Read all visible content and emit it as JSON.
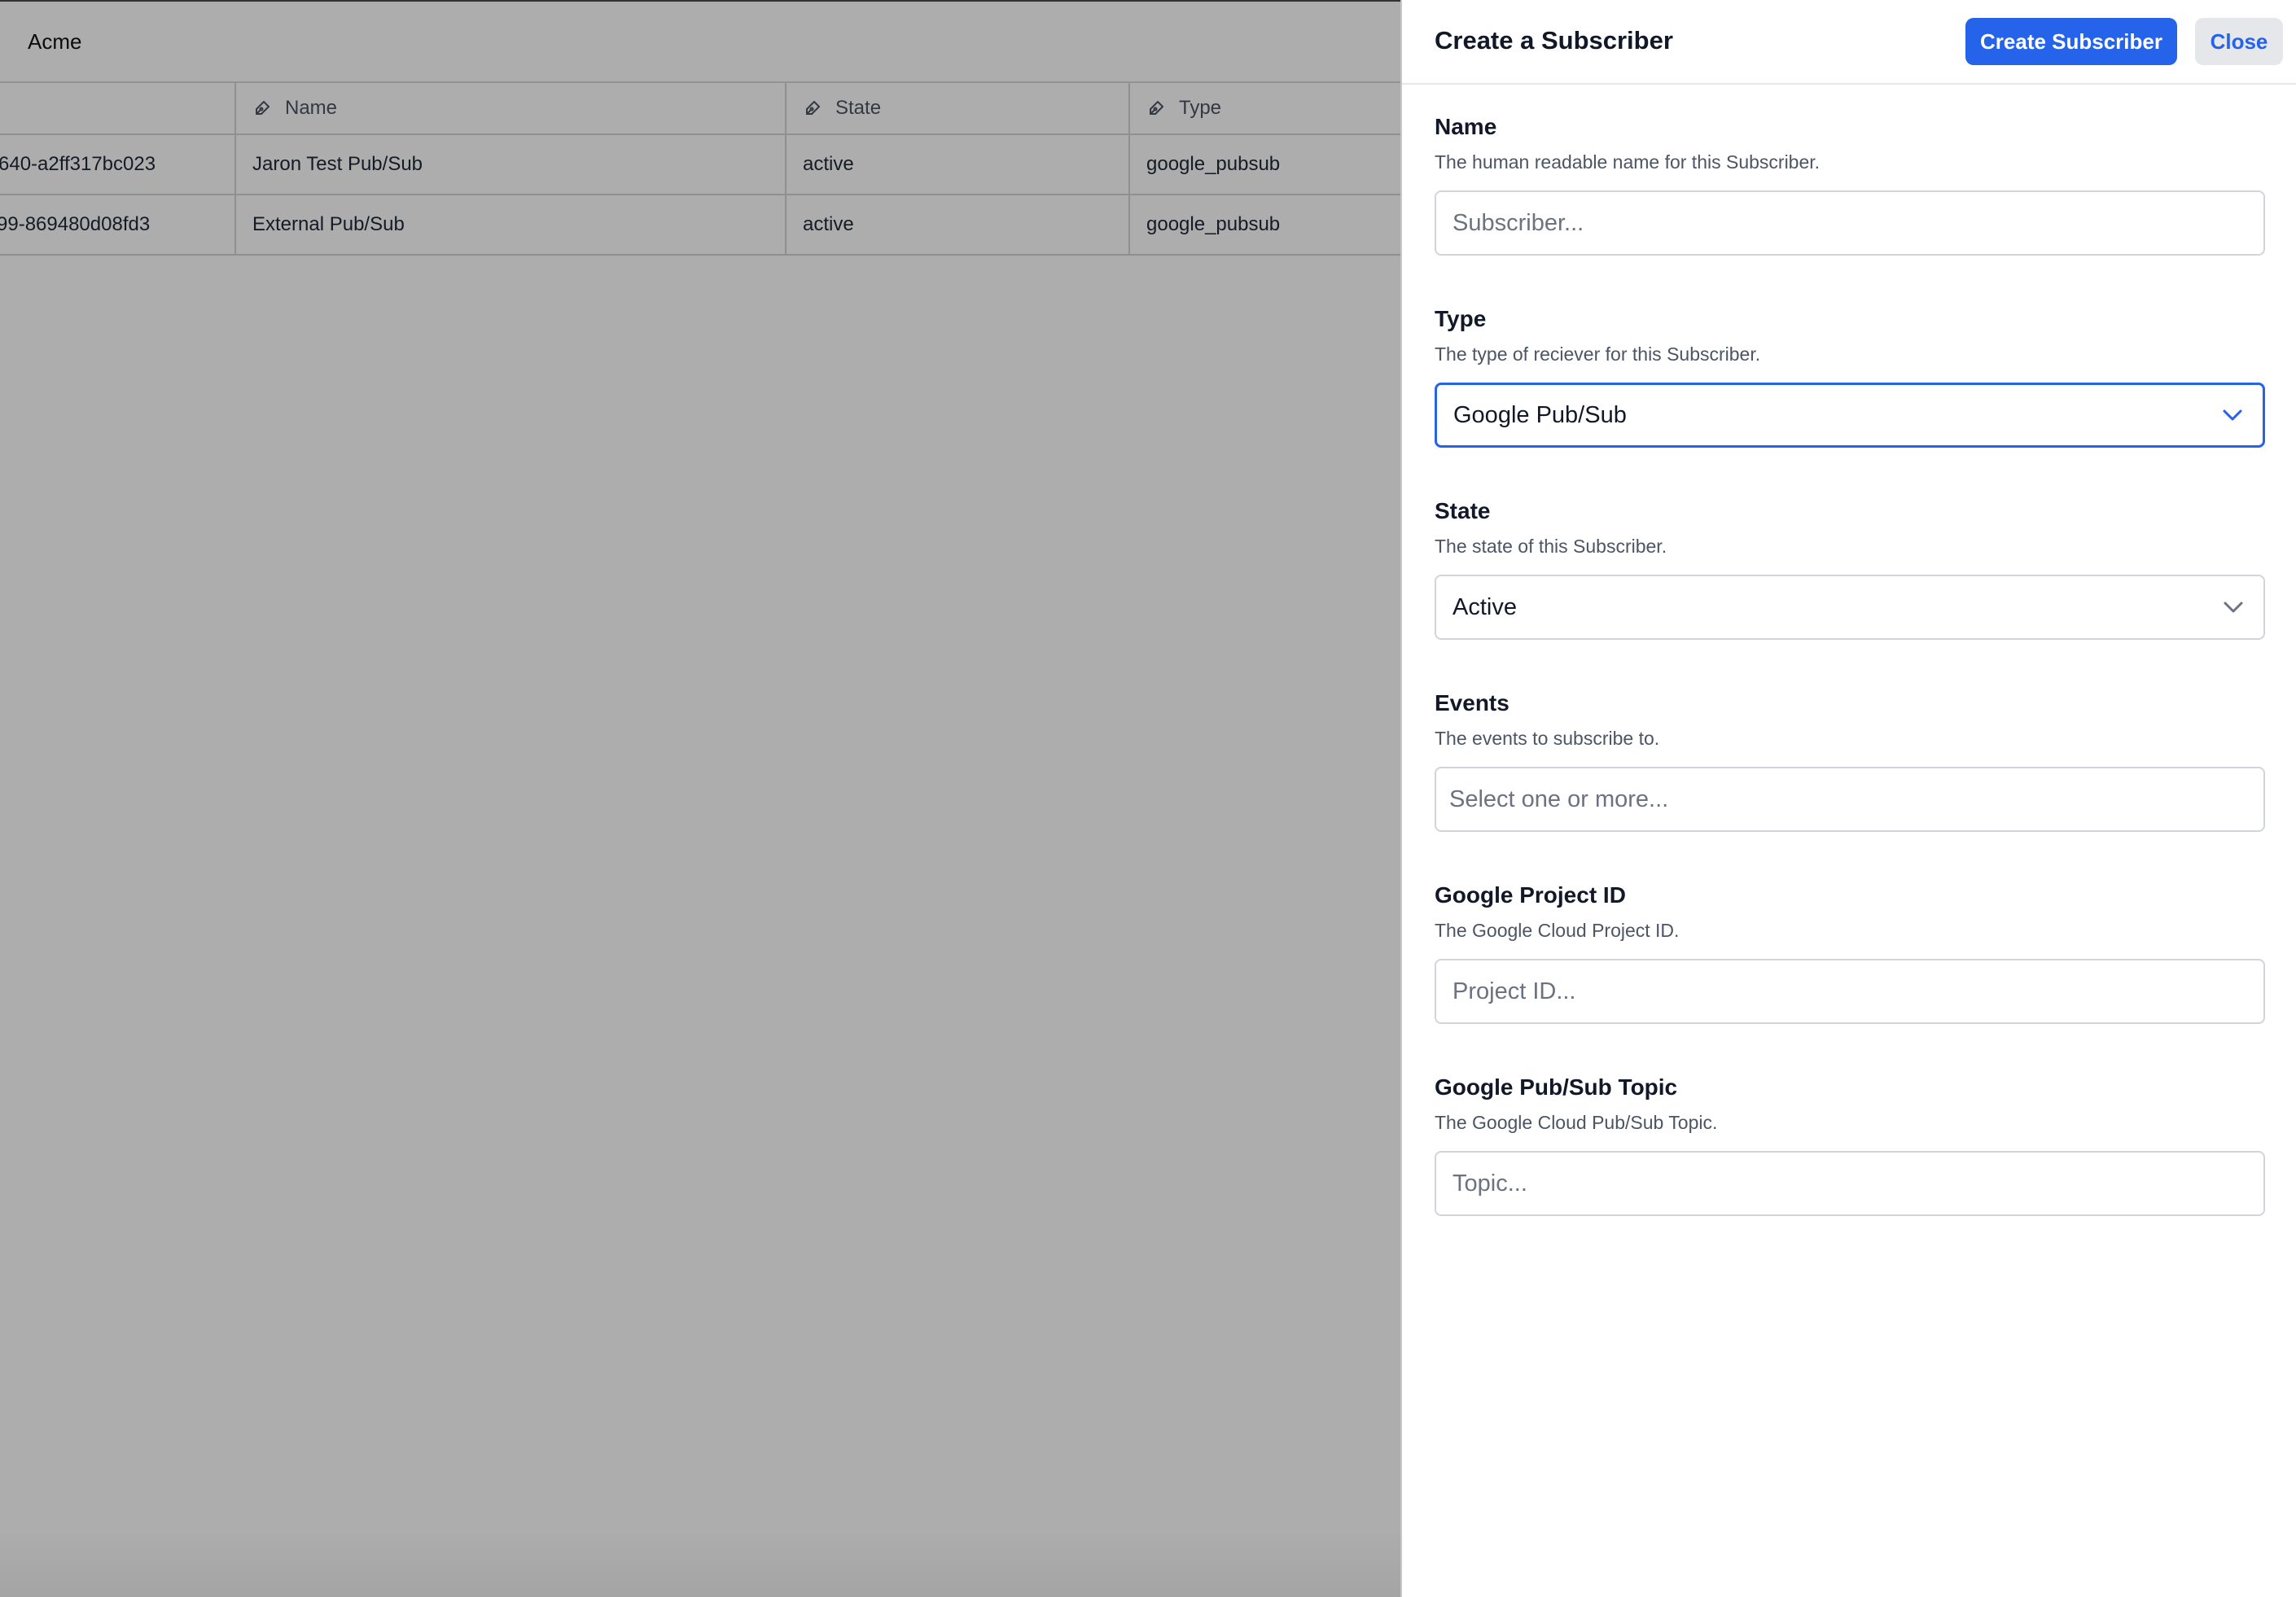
{
  "app": {
    "title": "Acme",
    "table": {
      "headers": [
        "Name",
        "State",
        "Type"
      ],
      "rows": [
        {
          "id": "640-a2ff317bc023",
          "name": "Jaron Test Pub/Sub",
          "state": "active",
          "type": "google_pubsub"
        },
        {
          "id": "99-869480d08fd3",
          "name": "External Pub/Sub",
          "state": "active",
          "type": "google_pubsub"
        }
      ]
    }
  },
  "panel": {
    "title": "Create a Subscriber",
    "create_button": "Create Subscriber",
    "close_button": "Close",
    "fields": {
      "name": {
        "label": "Name",
        "help": "The human readable name for this Subscriber.",
        "placeholder": "Subscriber..."
      },
      "type": {
        "label": "Type",
        "help": "The type of reciever for this Subscriber.",
        "value": "Google Pub/Sub"
      },
      "state": {
        "label": "State",
        "help": "The state of this Subscriber.",
        "value": "Active"
      },
      "events": {
        "label": "Events",
        "help": "The events to subscribe to.",
        "placeholder": "Select one or more..."
      },
      "project": {
        "label": "Google Project ID",
        "help": "The Google Cloud Project ID.",
        "placeholder": "Project ID..."
      },
      "topic": {
        "label": "Google Pub/Sub Topic",
        "help": "The Google Cloud Pub/Sub Topic.",
        "placeholder": "Topic..."
      }
    }
  },
  "colors": {
    "accent": "#2563eb",
    "overlay": "rgba(0,0,0,0.32)"
  },
  "icons": {
    "column_header": "pen-icon",
    "select": "chevron-down-icon"
  }
}
